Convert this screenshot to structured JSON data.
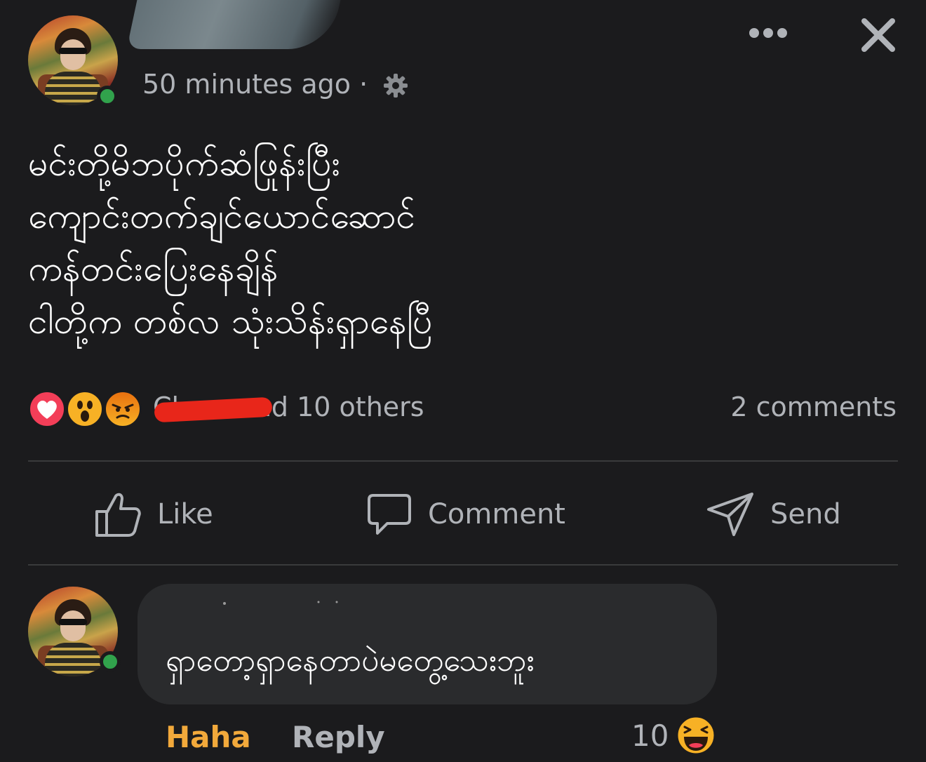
{
  "post": {
    "timestamp": "50 minutes ago ·",
    "body_lines": [
      "မင်းတို့မိဘပိုက်ဆံဖြုန်းပြီး",
      "ကျောင်းတက်ချင်ယောင်ဆောင်",
      "ကန်တင်းပြေးနေချိန်",
      "ငါတို့က တစ်လ သုံးသိန်းရှာနေပြီ"
    ],
    "reactions": {
      "types": [
        "love-icon",
        "wow-icon",
        "angry-icon"
      ],
      "names_text": "Cl    am and 10 others",
      "comment_count": "2 comments"
    }
  },
  "actions": {
    "like": "Like",
    "comment": "Comment",
    "send": "Send"
  },
  "comment": {
    "text": "ရှာတော့ရှာနေတာပဲမတွေ့သေးဘူး",
    "haha_label": "Haha",
    "reply_label": "Reply",
    "reaction_count": "10"
  },
  "colors": {
    "background": "#1b1b1d",
    "bubble": "#2a2b2d",
    "online": "#31a24c",
    "haha": "#f2a93b",
    "love": "#f33e58",
    "redaction": "#e8261a"
  }
}
